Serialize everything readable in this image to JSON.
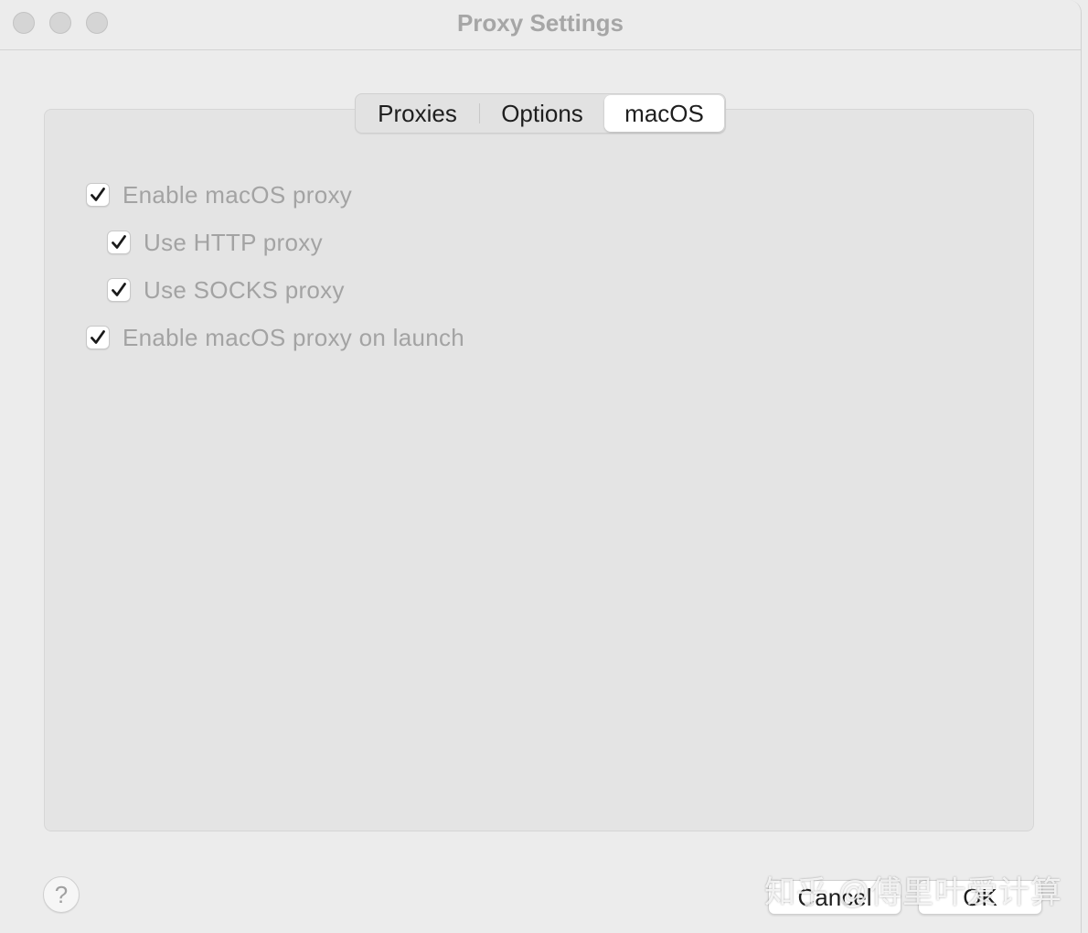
{
  "window": {
    "title": "Proxy Settings"
  },
  "tabs": [
    {
      "label": "Proxies",
      "selected": false
    },
    {
      "label": "Options",
      "selected": false
    },
    {
      "label": "macOS",
      "selected": true
    }
  ],
  "options": [
    {
      "label": "Enable macOS proxy",
      "checked": true
    },
    {
      "label": "Use HTTP proxy",
      "checked": true
    },
    {
      "label": "Use SOCKS proxy",
      "checked": true
    },
    {
      "label": "Enable macOS proxy on launch",
      "checked": true
    }
  ],
  "footer": {
    "help_label": "?",
    "cancel_label": "Cancel",
    "ok_label": "OK"
  },
  "watermark": "知乎 @傅里叶爱计算",
  "colors": {
    "window_bg": "#ececec",
    "panel_bg": "#e4e4e4",
    "disabled_text": "#a3a3a3",
    "title_text": "#a6a6a6"
  }
}
